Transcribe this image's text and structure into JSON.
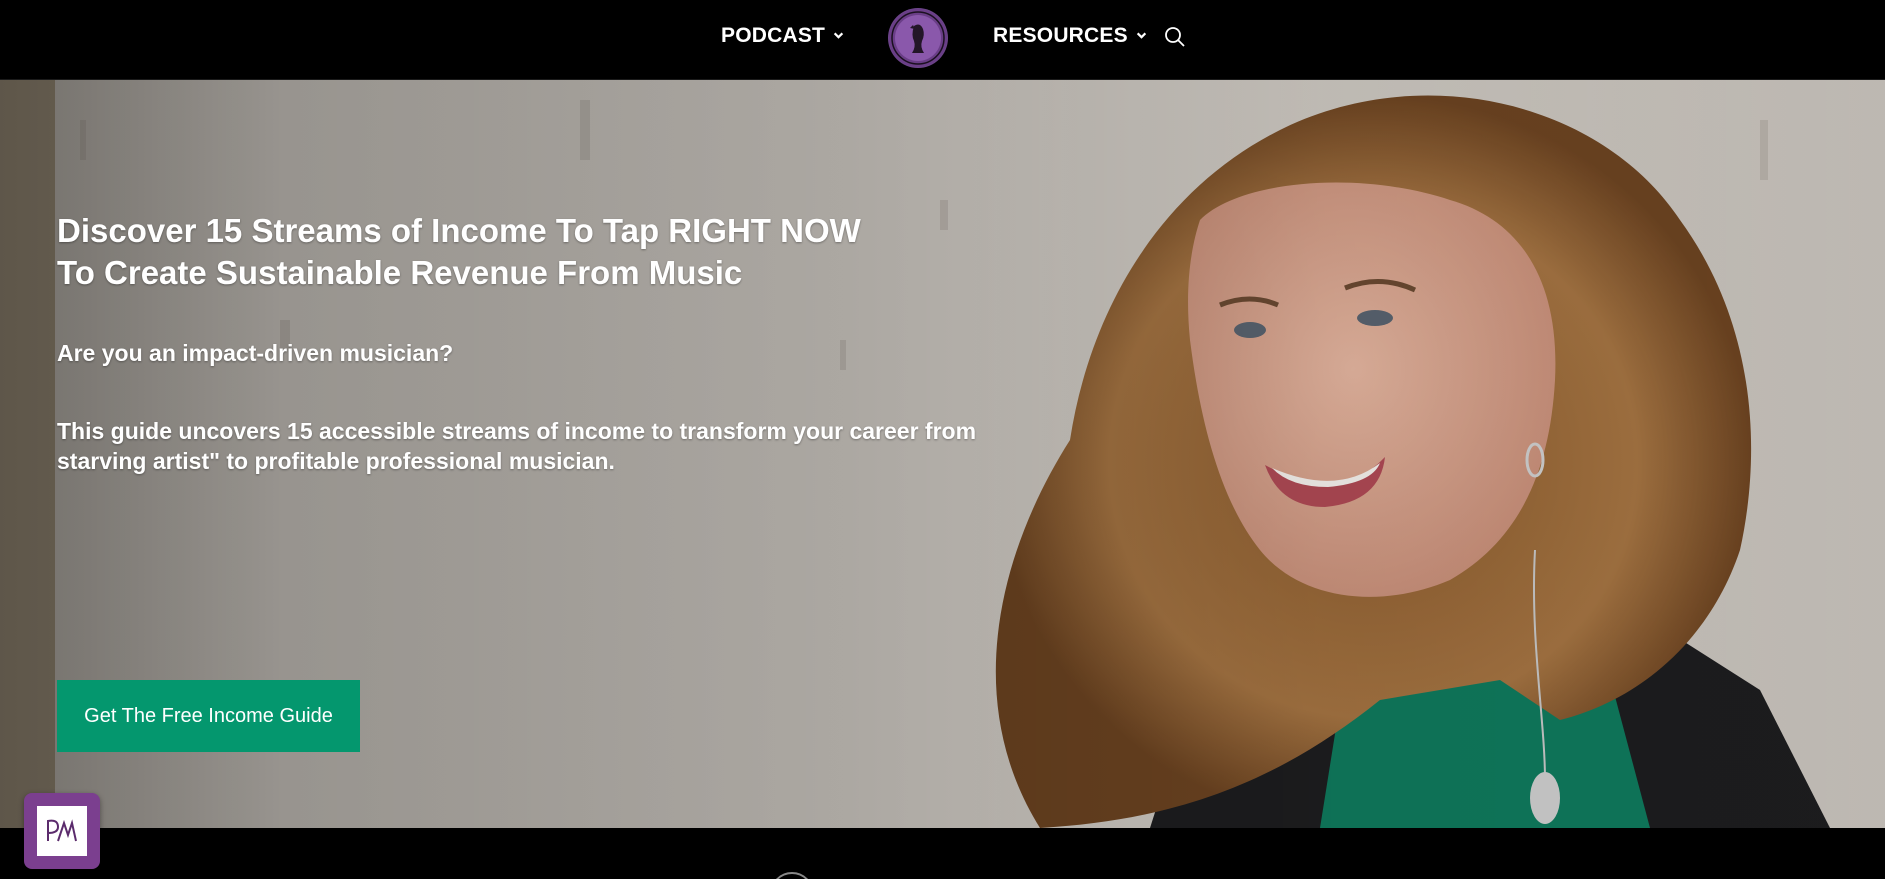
{
  "nav": {
    "podcast_label": "PODCAST",
    "resources_label": "RESOURCES",
    "logo_icon": "podcast-logo-icon",
    "search_icon": "search-icon"
  },
  "hero": {
    "title": "Discover 15 Streams of Income To Tap RIGHT NOW\nTo Create Sustainable Revenue From Music",
    "question": "Are you an impact-driven musician?",
    "description": "This guide uncovers 15 accessible streams of income to transform your career from\nstarving artist\" to profitable professional musician.",
    "cta_label": "Get The Free Income Guide"
  },
  "colors": {
    "nav_bg": "#000000",
    "cta_bg": "#04976e",
    "badge_bg": "#7b3f8f",
    "logo_purple": "#7d4b9f"
  },
  "badge": {
    "icon": "brand-monogram-icon"
  }
}
